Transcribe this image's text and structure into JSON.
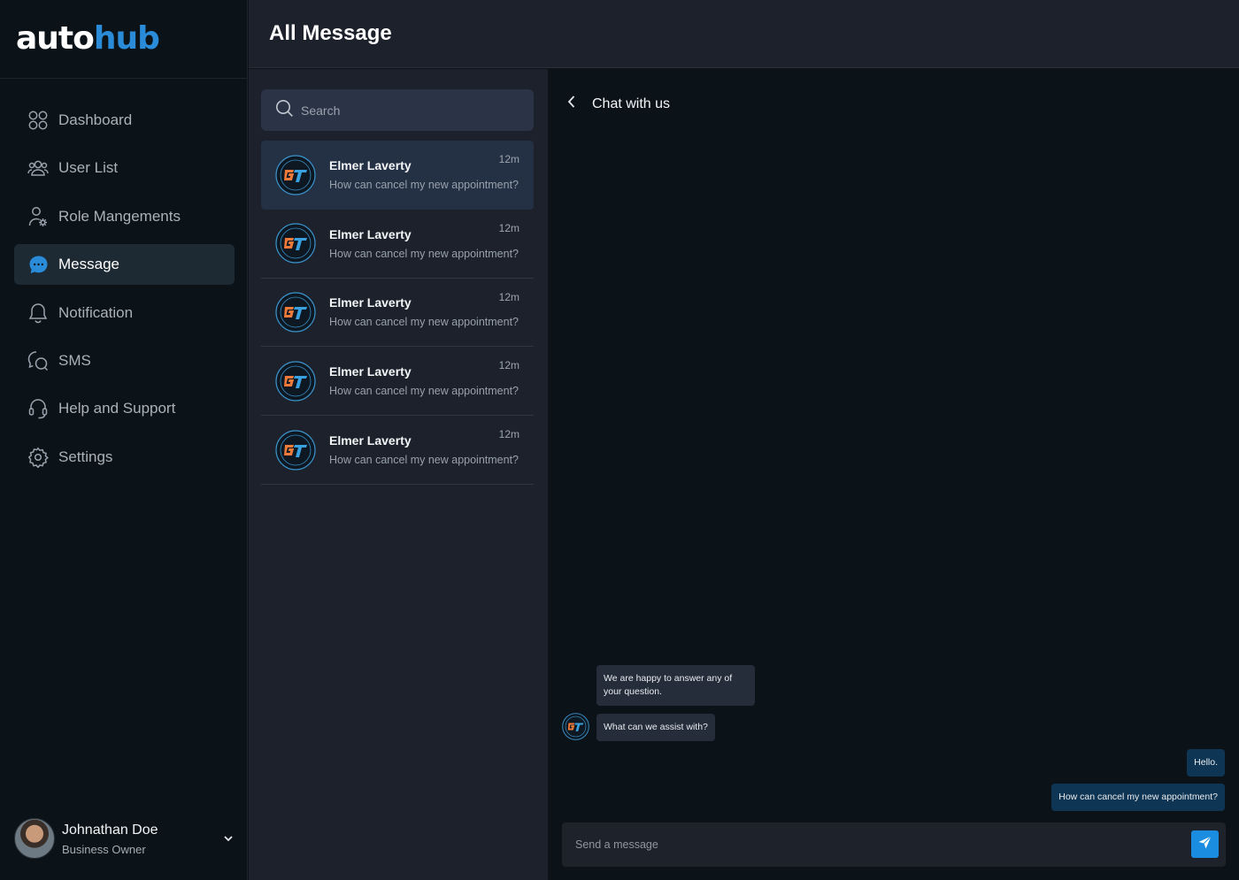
{
  "brand": {
    "logo_auto": "auto",
    "logo_hub": "hub",
    "accent": "#2a8bd8"
  },
  "header": {
    "title": "All Message"
  },
  "sidebar": {
    "items": [
      {
        "label": "Dashboard",
        "icon": "dashboard-icon"
      },
      {
        "label": "User List",
        "icon": "users-icon"
      },
      {
        "label": "Role Mangements",
        "icon": "user-settings-icon"
      },
      {
        "label": "Message",
        "icon": "message-icon",
        "active": true
      },
      {
        "label": "Notification",
        "icon": "bell-icon"
      },
      {
        "label": "SMS",
        "icon": "sms-icon"
      },
      {
        "label": "Help and Support",
        "icon": "headset-icon"
      },
      {
        "label": "Settings",
        "icon": "gear-icon"
      }
    ],
    "profile": {
      "name": "Johnathan Doe",
      "role": "Business Owner"
    }
  },
  "search": {
    "placeholder": "Search"
  },
  "conversations": [
    {
      "name": "Elmer Laverty",
      "preview": "How can cancel my new appointment?",
      "time": "12m",
      "active": true
    },
    {
      "name": "Elmer Laverty",
      "preview": "How can cancel my new appointment?",
      "time": "12m"
    },
    {
      "name": "Elmer Laverty",
      "preview": "How can cancel my new appointment?",
      "time": "12m"
    },
    {
      "name": "Elmer Laverty",
      "preview": "How can cancel my new appointment?",
      "time": "12m"
    },
    {
      "name": "Elmer Laverty",
      "preview": "How can cancel my new appointment?",
      "time": "12m"
    }
  ],
  "chat": {
    "title": "Chat with us",
    "messages": [
      {
        "from": "agent",
        "text": "We are happy to answer any of your question."
      },
      {
        "from": "agent",
        "text": "What can we assist with?"
      },
      {
        "from": "user",
        "text": "Hello."
      },
      {
        "from": "user",
        "text": "How can cancel my new appointment?"
      }
    ],
    "composer_placeholder": "Send a message"
  }
}
